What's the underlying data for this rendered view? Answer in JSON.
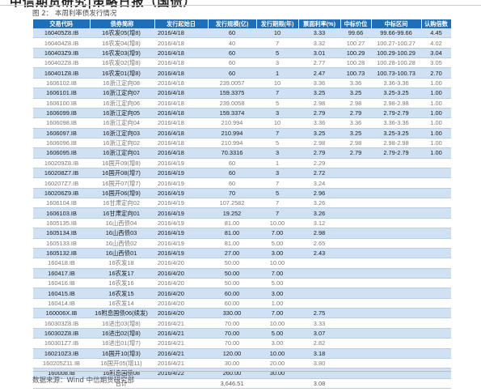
{
  "header": {
    "title": "中信期货研究|策略日报（国债）",
    "figure_label": "图 2：",
    "figure_title": "本周利率债发行情况"
  },
  "table": {
    "columns": [
      "交易代码",
      "债券简称",
      "发行起始日",
      "发行规模(亿)",
      "发行期限(年)",
      "票面利率(%)",
      "中标价位",
      "中标区间",
      "认购倍数"
    ],
    "rows": [
      {
        "style": "s",
        "cells": [
          "160405Z8.IB",
          "16农发05(增8)",
          "2016/4/18",
          "60",
          "10",
          "3.33",
          "99.66",
          "99.66-99.66",
          "4.45"
        ]
      },
      {
        "style": "d",
        "cells": [
          "160404Z8.IB",
          "16农发04(增8)",
          "2016/4/18",
          "40",
          "7",
          "3.32",
          "100.27",
          "100.27-100.27",
          "4.02"
        ]
      },
      {
        "style": "s",
        "cells": [
          "160403Z9.IB",
          "16农发03(增9)",
          "2016/4/18",
          "60",
          "5",
          "3.01",
          "100.29",
          "100.29-100.29",
          "3.04"
        ]
      },
      {
        "style": "d",
        "cells": [
          "160402Z8.IB",
          "16农发02(增8)",
          "2016/4/18",
          "60",
          "3",
          "2.77",
          "100.28",
          "100.28-100.28",
          "3.05"
        ]
      },
      {
        "style": "s",
        "cells": [
          "160401Z8.IB",
          "16农发01(增8)",
          "2016/4/18",
          "60",
          "1",
          "2.47",
          "100.73",
          "100.73-100.73",
          "2.70"
        ]
      },
      {
        "style": "d",
        "cells": [
          "1606102.IB",
          "16浙江定向08",
          "2016/4/18",
          "239.0057",
          "10",
          "3.36",
          "3.36",
          "3.36-3.36",
          "1.00"
        ]
      },
      {
        "style": "s",
        "cells": [
          "1606101.IB",
          "16浙江定向07",
          "2016/4/18",
          "159.3375",
          "7",
          "3.25",
          "3.25",
          "3.25-3.25",
          "1.00"
        ]
      },
      {
        "style": "d",
        "cells": [
          "1606100.IB",
          "16浙江定向06",
          "2016/4/18",
          "239.0058",
          "5",
          "2.98",
          "2.98",
          "2.98-2.98",
          "1.00"
        ]
      },
      {
        "style": "s",
        "cells": [
          "1606099.IB",
          "16浙江定向05",
          "2016/4/18",
          "159.3374",
          "3",
          "2.79",
          "2.79",
          "2.79-2.79",
          "1.00"
        ]
      },
      {
        "style": "d",
        "cells": [
          "1606098.IB",
          "16浙江定向04",
          "2016/4/18",
          "210.994",
          "10",
          "3.36",
          "3.36",
          "3.36-3.36",
          "1.00"
        ]
      },
      {
        "style": "s",
        "cells": [
          "1606097.IB",
          "16浙江定向03",
          "2016/4/18",
          "210.994",
          "7",
          "3.25",
          "3.25",
          "3.25-3.25",
          "1.00"
        ]
      },
      {
        "style": "d",
        "cells": [
          "1606096.IB",
          "16浙江定向02",
          "2016/4/18",
          "210.994",
          "5",
          "2.98",
          "2.98",
          "2.98-2.98",
          "1.00"
        ]
      },
      {
        "style": "s",
        "cells": [
          "1606095.IB",
          "16浙江定向01",
          "2016/4/18",
          "70.3316",
          "3",
          "2.79",
          "2.79",
          "2.79-2.79",
          "1.00"
        ]
      },
      {
        "style": "d",
        "cells": [
          "160209Z8.IB",
          "16国开09(增8)",
          "2016/4/19",
          "60",
          "1",
          "2.29",
          "",
          "",
          ""
        ]
      },
      {
        "style": "s",
        "cells": [
          "160208Z7.IB",
          "16国开08(增7)",
          "2016/4/19",
          "60",
          "3",
          "2.72",
          "",
          "",
          ""
        ]
      },
      {
        "style": "d",
        "cells": [
          "160207Z7.IB",
          "16国开07(增7)",
          "2016/4/19",
          "60",
          "7",
          "3.24",
          "",
          "",
          ""
        ]
      },
      {
        "style": "s",
        "cells": [
          "160206Z9.IB",
          "16国开06(增9)",
          "2016/4/19",
          "70",
          "5",
          "2.96",
          "",
          "",
          ""
        ]
      },
      {
        "style": "d",
        "cells": [
          "1606104.IB",
          "16甘肃定向02",
          "2016/4/19",
          "107.2582",
          "7",
          "3.26",
          "",
          "",
          ""
        ]
      },
      {
        "style": "s",
        "cells": [
          "1606103.IB",
          "16甘肃定向01",
          "2016/4/19",
          "19.252",
          "7",
          "3.26",
          "",
          "",
          ""
        ]
      },
      {
        "style": "d",
        "cells": [
          "1605135.IB",
          "16山西债04",
          "2016/4/19",
          "81.00",
          "10.00",
          "3.12",
          "",
          "",
          ""
        ]
      },
      {
        "style": "s",
        "cells": [
          "1605134.IB",
          "16山西债03",
          "2016/4/19",
          "81.00",
          "7.00",
          "2.98",
          "",
          "",
          ""
        ]
      },
      {
        "style": "d",
        "cells": [
          "1605133.IB",
          "16山西债02",
          "2016/4/19",
          "81.00",
          "5.00",
          "2.65",
          "",
          "",
          ""
        ]
      },
      {
        "style": "s",
        "cells": [
          "1605132.IB",
          "16山西债01",
          "2016/4/19",
          "27.00",
          "3.00",
          "2.43",
          "",
          "",
          ""
        ]
      },
      {
        "style": "d",
        "cells": [
          "160418.IB",
          "16农发18",
          "2016/4/20",
          "50.00",
          "10.00",
          "",
          "",
          "",
          ""
        ]
      },
      {
        "style": "s",
        "cells": [
          "160417.IB",
          "16农发17",
          "2016/4/20",
          "50.00",
          "7.00",
          "",
          "",
          "",
          ""
        ]
      },
      {
        "style": "d",
        "cells": [
          "160416.IB",
          "16农发16",
          "2016/4/20",
          "50.00",
          "5.00",
          "",
          "",
          "",
          ""
        ]
      },
      {
        "style": "s",
        "cells": [
          "160415.IB",
          "16农发15",
          "2016/4/20",
          "60.00",
          "3.00",
          "",
          "",
          "",
          ""
        ]
      },
      {
        "style": "d",
        "cells": [
          "160414.IB",
          "16农发14",
          "2016/4/20",
          "60.00",
          "1.00",
          "",
          "",
          "",
          ""
        ]
      },
      {
        "style": "s",
        "cells": [
          "160006X.IB",
          "16附息国债06(续发)",
          "2016/4/20",
          "330.00",
          "7.00",
          "2.75",
          "",
          "",
          ""
        ]
      },
      {
        "style": "d",
        "cells": [
          "160303Z8.IB",
          "16进出03(增8)",
          "2016/4/21",
          "70.00",
          "10.00",
          "3.33",
          "",
          "",
          ""
        ]
      },
      {
        "style": "s",
        "cells": [
          "160302Z8.IB",
          "16进出02(增8)",
          "2016/4/21",
          "70.00",
          "5.00",
          "3.07",
          "",
          "",
          ""
        ]
      },
      {
        "style": "d",
        "cells": [
          "160301Z7.IB",
          "16进出01(增7)",
          "2016/4/21",
          "70.00",
          "3.00",
          "2.82",
          "",
          "",
          ""
        ]
      },
      {
        "style": "s",
        "cells": [
          "160210Z3.IB",
          "16国开10(增3)",
          "2016/4/21",
          "120.00",
          "10.00",
          "3.18",
          "",
          "",
          ""
        ]
      },
      {
        "style": "d",
        "cells": [
          "160205Z11.IB",
          "16国开05(增11)",
          "2016/4/21",
          "30.00",
          "20.00",
          "3.80",
          "",
          "",
          ""
        ]
      },
      {
        "style": "s",
        "cells": [
          "160008.IB",
          "16附息国债08",
          "2016/4/22",
          "260.00",
          "30.00",
          "",
          "",
          "",
          ""
        ]
      },
      {
        "style": "t",
        "cells": [
          "",
          "合计",
          "",
          "3,646.51",
          "",
          "3.08",
          "",
          "",
          ""
        ]
      }
    ]
  },
  "footer": {
    "source": "数据来源：Wind    中信期货研究部"
  },
  "colors": {
    "header_bg": "#1c6fb8",
    "stripe_bg": "#cfe1f3"
  }
}
